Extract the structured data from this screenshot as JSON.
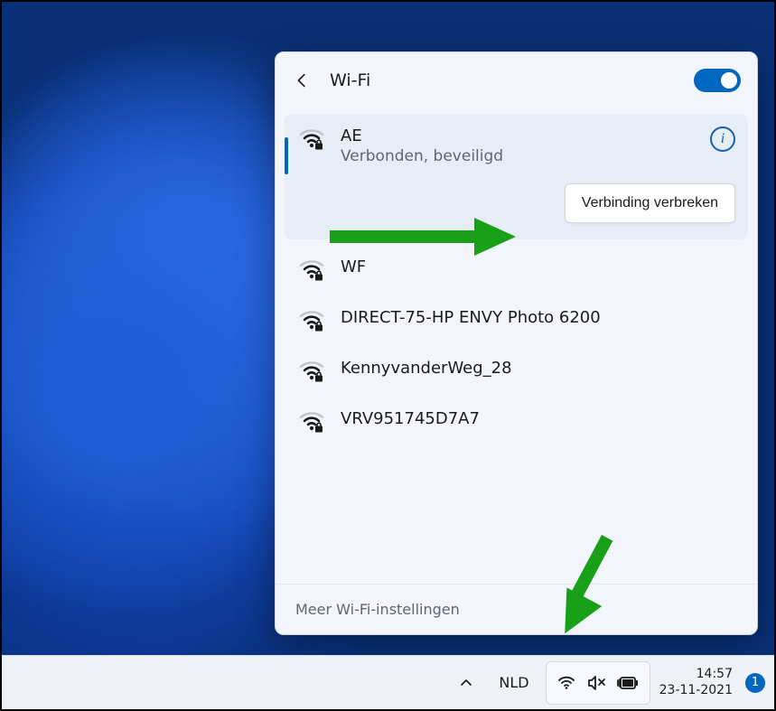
{
  "panel": {
    "title": "Wi-Fi",
    "toggle_on": true,
    "more_settings": "Meer Wi-Fi-instellingen"
  },
  "networks": [
    {
      "name": "AE",
      "status": "Verbonden, beveiligd",
      "secured": true,
      "connected": true
    },
    {
      "name": "WF",
      "secured": true
    },
    {
      "name": "DIRECT-75-HP ENVY Photo 6200",
      "secured": true
    },
    {
      "name": "KennyvanderWeg_28",
      "secured": true
    },
    {
      "name": "VRV951745D7A7",
      "secured": true
    }
  ],
  "actions": {
    "disconnect": "Verbinding verbreken"
  },
  "taskbar": {
    "language": "NLD",
    "time": "14:57",
    "date": "23-11-2021",
    "notification_count": "1"
  }
}
